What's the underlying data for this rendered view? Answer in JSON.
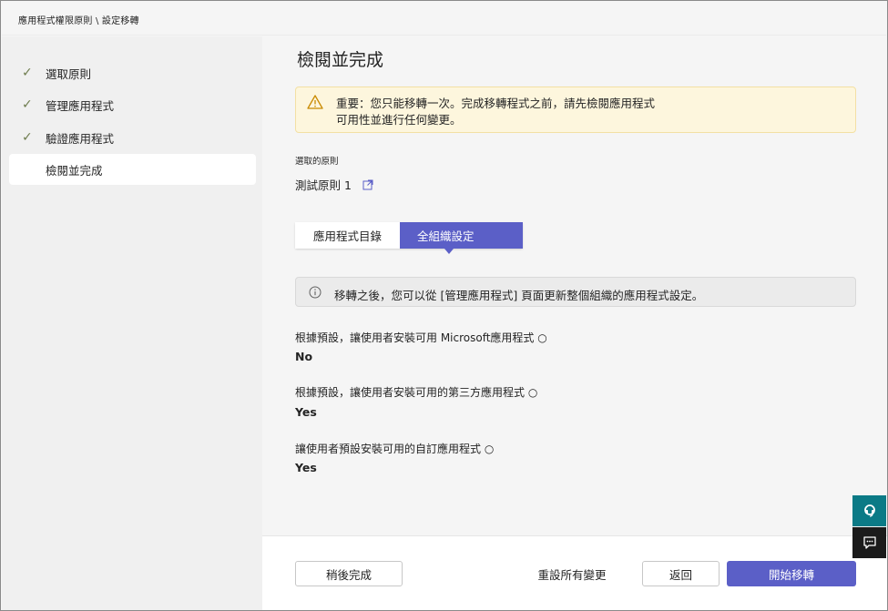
{
  "breadcrumb": "應用程式權限原則 \\ 設定移轉",
  "steps": [
    {
      "label": "選取原則",
      "done": true
    },
    {
      "label": "管理應用程式",
      "done": true
    },
    {
      "label": "驗證應用程式",
      "done": true
    },
    {
      "label": "檢閱並完成",
      "active": true
    }
  ],
  "main": {
    "title": "檢閱並完成",
    "warning": {
      "line1": "重要：您只能移轉一次。完成移轉程式之前，請先檢閱應用程式",
      "line2": "可用性並進行任何變更。"
    },
    "selected_policy_label": "選取的原則",
    "selected_policy_name": "測試原則 1",
    "tabs": [
      {
        "label": "應用程式目錄",
        "selected": false
      },
      {
        "label": "全組織設定",
        "selected": true
      }
    ],
    "info": "移轉之後，您可以從 [管理應用程式] 頁面更新整個組織的應用程式設定。",
    "settings": [
      {
        "label": "根據預設，讓使用者安裝可用 Microsoft應用程式 ○",
        "value": "No"
      },
      {
        "label": "根據預設，讓使用者安裝可用的第三方應用程式 ○",
        "value": "Yes"
      },
      {
        "label": "讓使用者預設安裝可用的自訂應用程式 ○",
        "value": "Yes"
      }
    ]
  },
  "footer": {
    "finish_later": "稍後完成",
    "reset_all": "重設所有變更",
    "back": "返回",
    "start_migration": "開始移轉"
  },
  "colors": {
    "accent": "#5b5fc7",
    "warning_bg": "#fdf6dd",
    "check": "#6f7d4f",
    "help_bg": "#0b7a86",
    "feedback_bg": "#1b1b1b"
  },
  "icons": {
    "check": "checkmark-icon",
    "warning": "warning-icon",
    "info": "info-icon",
    "external": "open-external-icon",
    "help": "help-headset-icon",
    "feedback": "feedback-icon"
  }
}
